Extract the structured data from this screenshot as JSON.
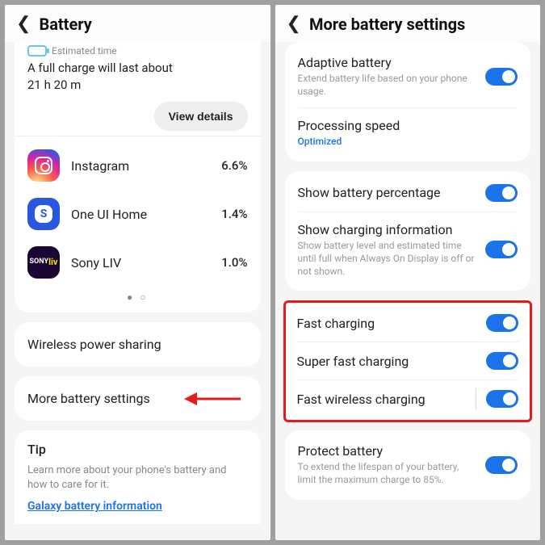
{
  "left": {
    "header": {
      "title": "Battery"
    },
    "estimated_label": "Estimated time",
    "charge_text_1": "A full charge will last about",
    "charge_text_2": "21 h 20 m",
    "view_details": "View details",
    "apps": [
      {
        "name": "Instagram",
        "pct": "6.6%"
      },
      {
        "name": "One UI Home",
        "pct": "1.4%"
      },
      {
        "name": "Sony LIV",
        "pct": "1.0%"
      }
    ],
    "wireless_power": "Wireless power sharing",
    "more_settings": "More battery settings",
    "tip_title": "Tip",
    "tip_text": "Learn more about your phone's battery and how to care for it.",
    "tip_link": "Galaxy battery information"
  },
  "right": {
    "header": {
      "title": "More battery settings"
    },
    "adaptive": {
      "title": "Adaptive battery",
      "sub": "Extend battery life based on your phone usage."
    },
    "processing": {
      "title": "Processing speed",
      "sub": "Optimized"
    },
    "show_pct": {
      "title": "Show battery percentage"
    },
    "show_charge": {
      "title": "Show charging information",
      "sub": "Show battery level and estimated time until full when Always On Display is off or not shown."
    },
    "fast": {
      "title": "Fast charging"
    },
    "super_fast": {
      "title": "Super fast charging"
    },
    "fast_wireless": {
      "title": "Fast wireless charging"
    },
    "protect": {
      "title": "Protect battery",
      "sub": "To extend the lifespan of your battery, limit the maximum charge to 85%."
    }
  }
}
